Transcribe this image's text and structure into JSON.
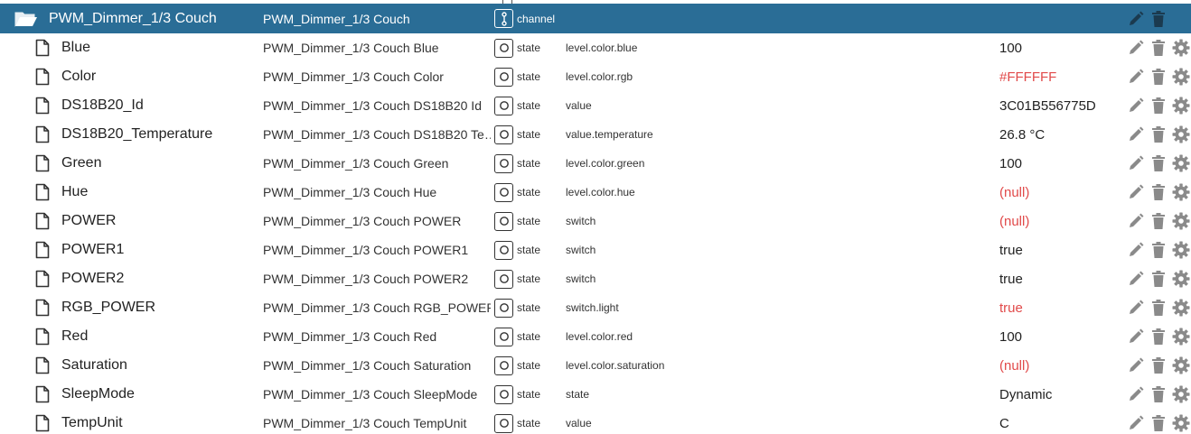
{
  "channel": {
    "id": "PWM_Dimmer_1/3 Couch",
    "name": "PWM_Dimmer_1/3 Couch",
    "type": "channel",
    "icon": "folder-open-icon"
  },
  "rows": [
    {
      "id": "Blue",
      "name": "PWM_Dimmer_1/3 Couch Blue",
      "type": "state",
      "role": "level.color.blue",
      "value": "100",
      "value_color": "normal"
    },
    {
      "id": "Color",
      "name": "PWM_Dimmer_1/3 Couch Color",
      "type": "state",
      "role": "level.color.rgb",
      "value": "#FFFFFF",
      "value_color": "red"
    },
    {
      "id": "DS18B20_Id",
      "name": "PWM_Dimmer_1/3 Couch DS18B20 Id",
      "type": "state",
      "role": "value",
      "value": "3C01B556775D",
      "value_color": "normal"
    },
    {
      "id": "DS18B20_Temperature",
      "name": "PWM_Dimmer_1/3 Couch DS18B20 Te…",
      "type": "state",
      "role": "value.temperature",
      "value": "26.8 °C",
      "value_color": "normal"
    },
    {
      "id": "Green",
      "name": "PWM_Dimmer_1/3 Couch Green",
      "type": "state",
      "role": "level.color.green",
      "value": "100",
      "value_color": "normal"
    },
    {
      "id": "Hue",
      "name": "PWM_Dimmer_1/3 Couch Hue",
      "type": "state",
      "role": "level.color.hue",
      "value": "(null)",
      "value_color": "red"
    },
    {
      "id": "POWER",
      "name": "PWM_Dimmer_1/3 Couch POWER",
      "type": "state",
      "role": "switch",
      "value": "(null)",
      "value_color": "red"
    },
    {
      "id": "POWER1",
      "name": "PWM_Dimmer_1/3 Couch POWER1",
      "type": "state",
      "role": "switch",
      "value": "true",
      "value_color": "normal"
    },
    {
      "id": "POWER2",
      "name": "PWM_Dimmer_1/3 Couch POWER2",
      "type": "state",
      "role": "switch",
      "value": "true",
      "value_color": "normal"
    },
    {
      "id": "RGB_POWER",
      "name": "PWM_Dimmer_1/3 Couch RGB_POWER",
      "type": "state",
      "role": "switch.light",
      "value": "true",
      "value_color": "red"
    },
    {
      "id": "Red",
      "name": "PWM_Dimmer_1/3 Couch Red",
      "type": "state",
      "role": "level.color.red",
      "value": "100",
      "value_color": "normal"
    },
    {
      "id": "Saturation",
      "name": "PWM_Dimmer_1/3 Couch Saturation",
      "type": "state",
      "role": "level.color.saturation",
      "value": "(null)",
      "value_color": "red"
    },
    {
      "id": "SleepMode",
      "name": "PWM_Dimmer_1/3 Couch SleepMode",
      "type": "state",
      "role": "state",
      "value": "Dynamic",
      "value_color": "normal"
    },
    {
      "id": "TempUnit",
      "name": "PWM_Dimmer_1/3 Couch TempUnit",
      "type": "state",
      "role": "value",
      "value": "C",
      "value_color": "normal"
    }
  ],
  "icons": {
    "row_icon": "file-icon",
    "state_type": "state-circle-icon",
    "channel_type": "channel-icon",
    "edit": "pencil-icon",
    "delete": "trash-icon",
    "config": "gear-icon"
  },
  "colors": {
    "channel_bg": "#2a6d96",
    "red_value": "#e14a4a",
    "action_gray": "#8a8a8a"
  }
}
